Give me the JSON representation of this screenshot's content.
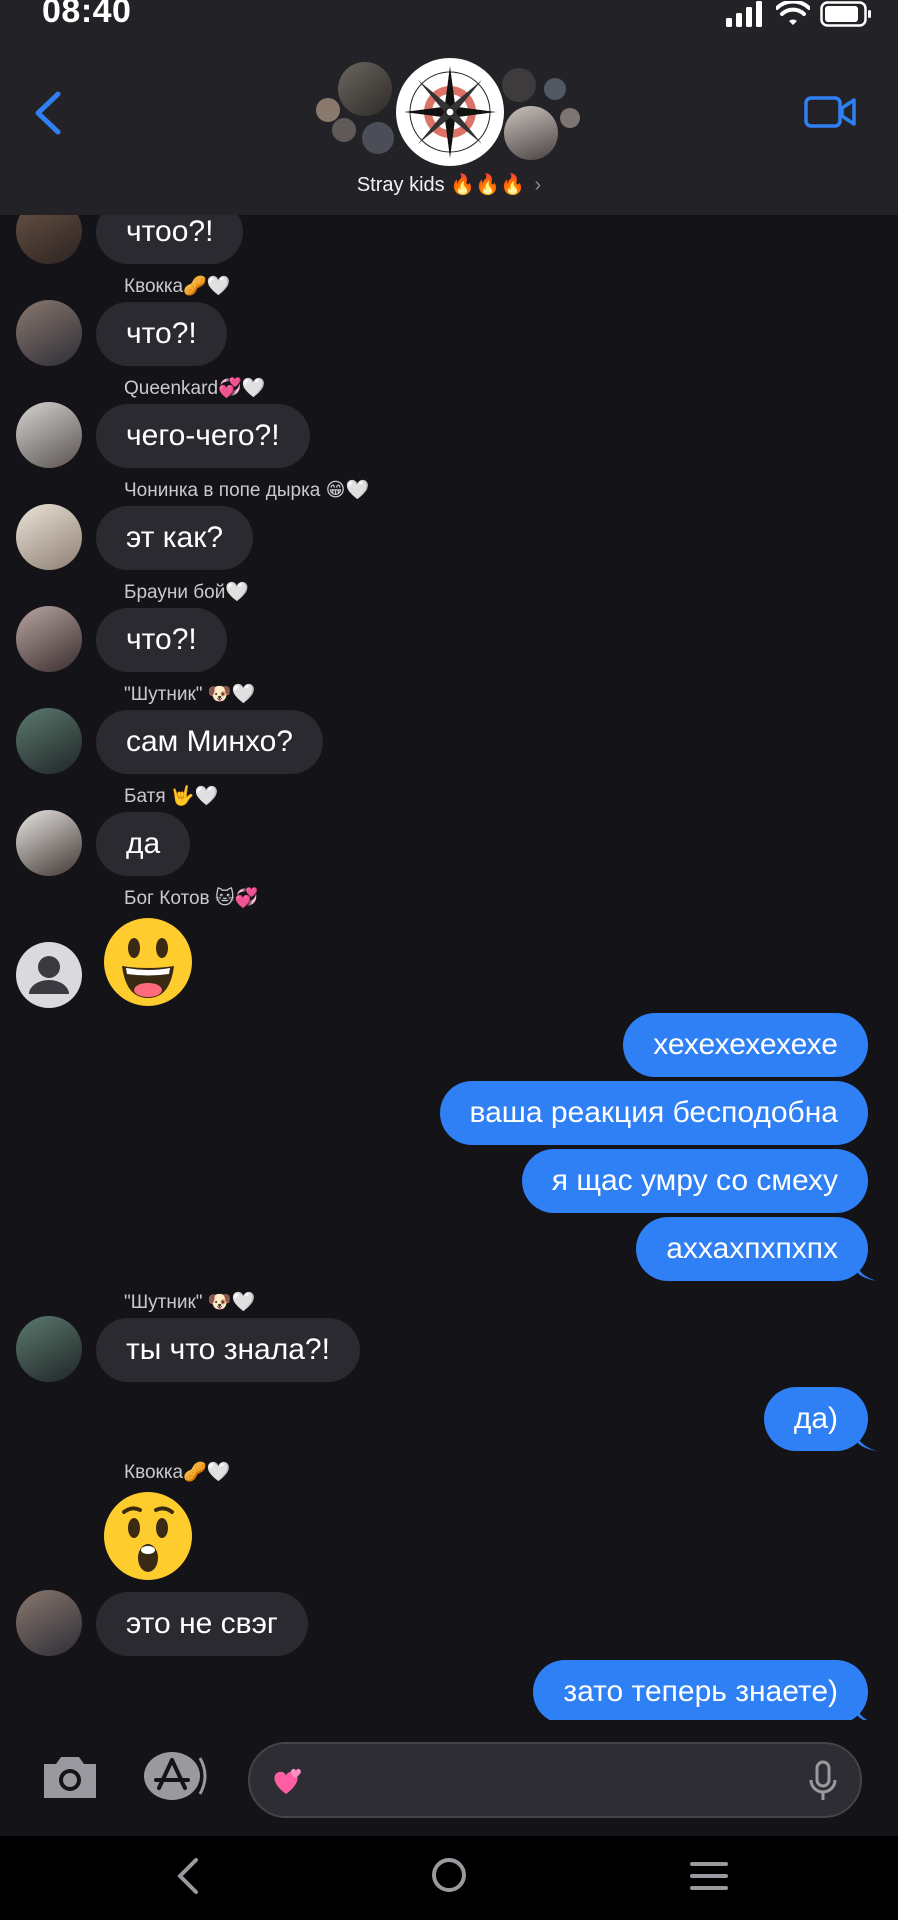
{
  "status_bar": {
    "time": "08:40"
  },
  "header": {
    "title": "Stray kids 🔥🔥🔥",
    "chevron": "›",
    "back_icon": "chevron-left-icon",
    "video_icon": "video-camera-icon"
  },
  "messages": [
    {
      "side": "in",
      "text": "чтоо?!"
    },
    {
      "side": "in",
      "sender": "Квокка🥜🤍",
      "text": "что?!"
    },
    {
      "side": "in",
      "sender": "Queenkard💞🤍",
      "text": "чего-чего?!"
    },
    {
      "side": "in",
      "sender": "Чонинка в попе дырка 😁🤍",
      "text": "эт как?"
    },
    {
      "side": "in",
      "sender": "Брауни бой🤍",
      "text": "что?!"
    },
    {
      "side": "in",
      "sender": "\"Шутник\" 🐶🤍",
      "text": "сам Минхо?"
    },
    {
      "side": "in",
      "sender": "Батя 🤟🤍",
      "text": "да"
    },
    {
      "side": "in",
      "sender": "Бог Котов 🐱💞",
      "emoji": "😃"
    },
    {
      "side": "out",
      "text": "хехехехехехе"
    },
    {
      "side": "out",
      "text": "ваша реакция бесподобна"
    },
    {
      "side": "out",
      "text": "я щас умру со смеху"
    },
    {
      "side": "out",
      "text": "аххахпхпхпх"
    },
    {
      "side": "in",
      "sender": "\"Шутник\" 🐶🤍",
      "text": "ты что знала?!"
    },
    {
      "side": "out",
      "text": "да)"
    },
    {
      "side": "in",
      "sender": "Квокка🥜🤍",
      "emoji": "😲"
    },
    {
      "side": "in",
      "text": "это не свэг"
    },
    {
      "side": "out",
      "text": "зато теперь знаете)"
    }
  ],
  "composer": {
    "emoji": "💞",
    "placeholder": "",
    "camera_icon": "camera-icon",
    "apps_icon": "app-store-icon",
    "mic_icon": "microphone-icon"
  },
  "navbar": {
    "icons": [
      "nav-back-icon",
      "nav-home-icon",
      "nav-recents-icon"
    ]
  },
  "colors": {
    "outgoing": "#2f7ff5",
    "incoming": "#2b2a30",
    "accent": "#2f7ff5"
  }
}
